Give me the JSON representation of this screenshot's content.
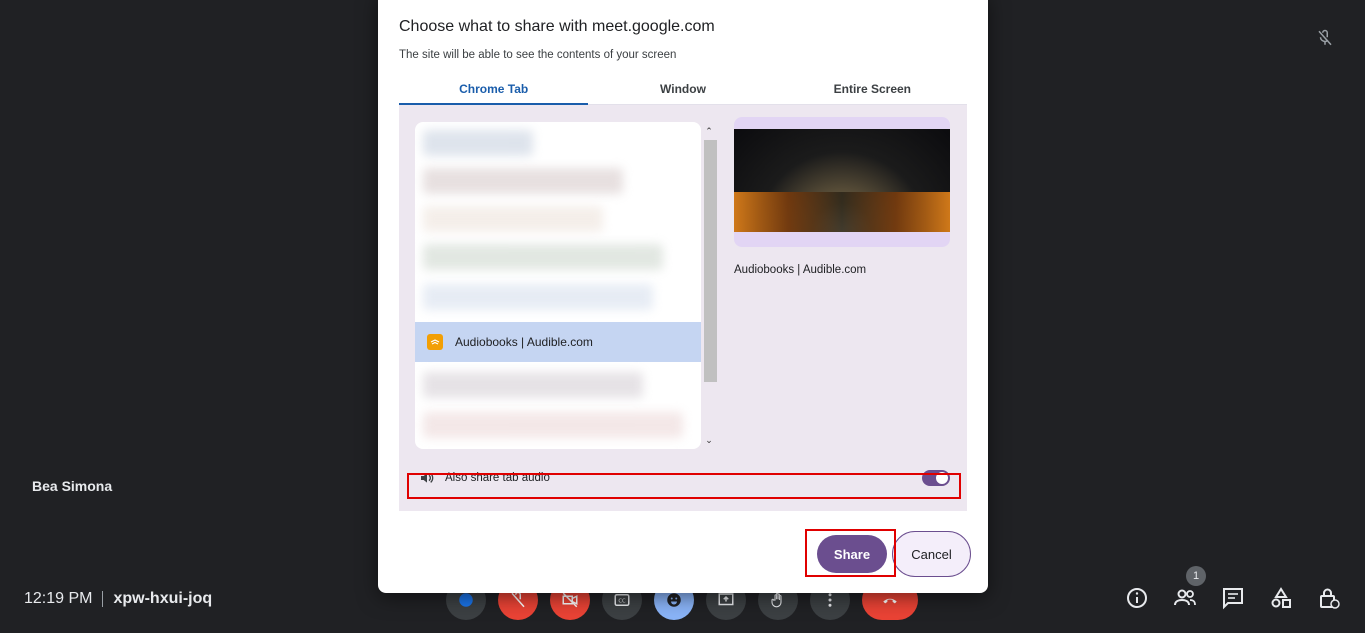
{
  "meet": {
    "participant_name": "Bea Simona",
    "time": "12:19 PM",
    "meeting_code": "xpw-hxui-joq",
    "people_count": "1"
  },
  "dialog": {
    "title": "Choose what to share with meet.google.com",
    "subtitle": "The site will be able to see the contents of your screen",
    "tabs": [
      {
        "label": "Chrome Tab",
        "active": true
      },
      {
        "label": "Window",
        "active": false
      },
      {
        "label": "Entire Screen",
        "active": false
      }
    ],
    "selected_tab_item": "Audiobooks | Audible.com",
    "preview_caption": "Audiobooks | Audible.com",
    "audio_label": "Also share tab audio",
    "audio_enabled": true,
    "share_label": "Share",
    "cancel_label": "Cancel"
  },
  "colors": {
    "accent": "#6b4e8f",
    "tab_active": "#1a5dab",
    "highlight": "#e00000"
  },
  "icons": {
    "top_right": "mic-off-icon",
    "controls": [
      "blue-dot-icon",
      "mic-off-icon",
      "camera-off-icon",
      "captions-icon",
      "emoji-icon",
      "present-icon",
      "raise-hand-icon",
      "more-icon",
      "hangup-icon"
    ],
    "right": [
      "info-icon",
      "people-icon",
      "chat-icon",
      "activities-icon",
      "host-controls-icon"
    ]
  }
}
